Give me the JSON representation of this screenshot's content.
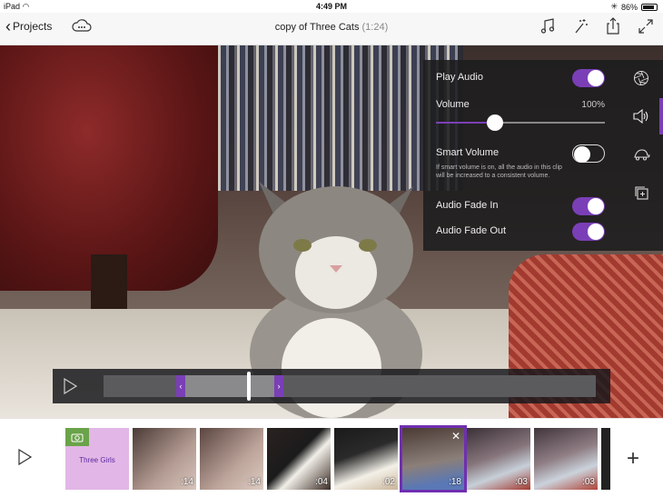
{
  "status_bar": {
    "device": "iPad",
    "time": "4:49 PM",
    "battery": "86%"
  },
  "nav": {
    "back_label": "Projects",
    "title": "copy of Three Cats",
    "duration": "(1:24)"
  },
  "audio_panel": {
    "play_audio_label": "Play Audio",
    "play_audio_on": true,
    "volume_label": "Volume",
    "volume_value": "100%",
    "volume_level": 0.35,
    "smart_volume_label": "Smart Volume",
    "smart_volume_on": false,
    "smart_volume_note": "If smart volume is on, all the audio in this clip will be increased to a consistent volume.",
    "fade_in_label": "Audio Fade In",
    "fade_in_on": true,
    "fade_out_label": "Audio Fade Out",
    "fade_out_on": true
  },
  "side_rail": [
    "aperture-icon",
    "speaker-icon",
    "turtle-icon",
    "duplicate-icon"
  ],
  "scrubber": {
    "left_handle": "‹",
    "right_handle": "›"
  },
  "timeline": {
    "clips": [
      {
        "type": "title",
        "label": "Three Girls"
      },
      {
        "type": "video",
        "duration": ":14"
      },
      {
        "type": "video",
        "duration": ":14"
      },
      {
        "type": "video",
        "duration": ":04"
      },
      {
        "type": "video",
        "duration": ":02"
      },
      {
        "type": "video",
        "duration": ":18",
        "selected": true
      },
      {
        "type": "video",
        "duration": ":03"
      },
      {
        "type": "video",
        "duration": ":03"
      }
    ],
    "add_label": "+"
  },
  "colors": {
    "accent": "#7a3fb6"
  }
}
